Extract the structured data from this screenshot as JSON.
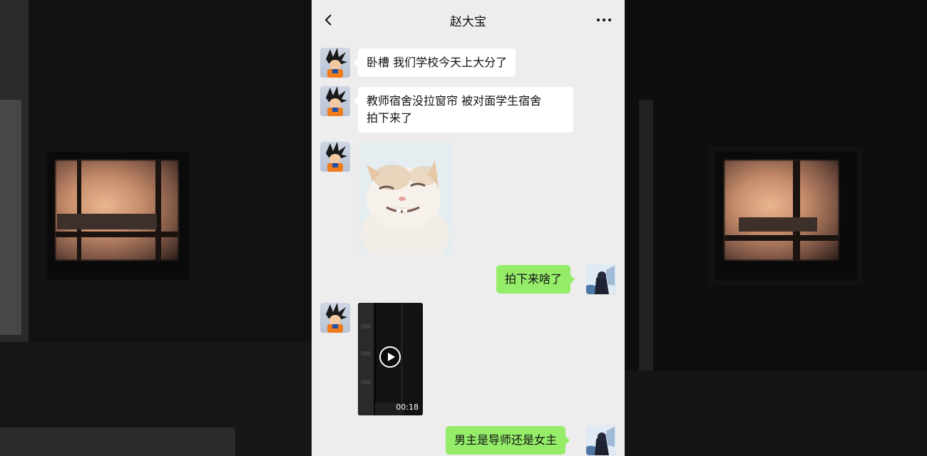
{
  "chat": {
    "title": "赵大宝",
    "back_icon": "chevron-left-icon",
    "more_icon": "ellipsis-icon"
  },
  "messages": [
    {
      "from": "contact",
      "type": "text",
      "text": "卧槽 我们学校今天上大分了"
    },
    {
      "from": "contact",
      "type": "text",
      "lines": [
        "教师宿舍没拉窗帘 被对面学生宿舍",
        "拍下来了"
      ]
    },
    {
      "from": "contact",
      "type": "image",
      "icon": "smiling-cat-sticker"
    },
    {
      "from": "me",
      "type": "text",
      "text": "拍下来啥了"
    },
    {
      "from": "contact",
      "type": "video",
      "duration": "00:18",
      "icon": "play-icon"
    },
    {
      "from": "me",
      "type": "text",
      "text": "男主是导师还是女主"
    }
  ],
  "colors": {
    "incoming_bubble": "#ffffff",
    "outgoing_bubble": "#95ec69",
    "chat_background": "#ededed"
  }
}
